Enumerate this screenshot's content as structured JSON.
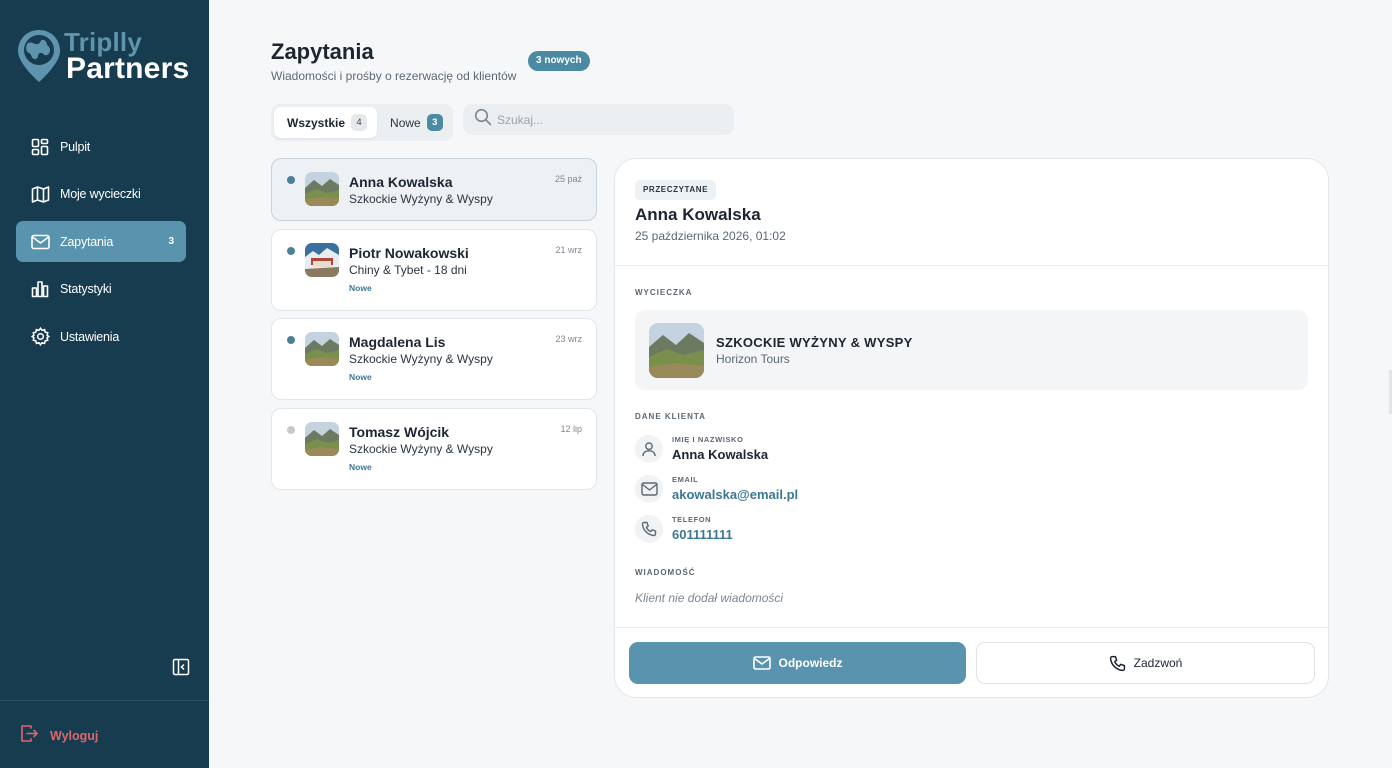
{
  "brand": {
    "name_top": "Triplly",
    "name_bottom": "Partners",
    "color_primary": "#173c4f",
    "color_accent": "#5a93ad"
  },
  "sidebar": {
    "items": [
      {
        "label": "Pulpit",
        "icon": "dashboard-icon",
        "active": false
      },
      {
        "label": "Moje wycieczki",
        "icon": "map-icon",
        "active": false
      },
      {
        "label": "Zapytania",
        "icon": "mail-icon",
        "active": true,
        "count": "3"
      },
      {
        "label": "Statystyki",
        "icon": "bar-chart-icon",
        "active": false
      },
      {
        "label": "Ustawienia",
        "icon": "gear-icon",
        "active": false
      }
    ],
    "logout_label": "Wyloguj",
    "logout_color": "#e0656b"
  },
  "header": {
    "title": "Zapytania",
    "subtitle": "Wiadomości i prośby o rezerwację od klientów",
    "new_badge": "3 nowych"
  },
  "tabs": [
    {
      "label": "Wszystkie",
      "count": "4",
      "active": true
    },
    {
      "label": "Nowe",
      "count": "3",
      "active": false
    }
  ],
  "search": {
    "placeholder": "Szukaj...",
    "value": ""
  },
  "inquiries": [
    {
      "name": "Anna Kowalska",
      "trip": "Szkockie Wyżyny & Wyspy",
      "date": "25 paź",
      "unread_dot": true,
      "new_label": "",
      "selected": true
    },
    {
      "name": "Piotr Nowakowski",
      "trip": "Chiny & Tybet - 18 dni",
      "date": "21 wrz",
      "unread_dot": true,
      "new_label": "Nowe",
      "selected": false
    },
    {
      "name": "Magdalena Lis",
      "trip": "Szkockie Wyżyny & Wyspy",
      "date": "23 wrz",
      "unread_dot": true,
      "new_label": "Nowe",
      "selected": false
    },
    {
      "name": "Tomasz Wójcik",
      "trip": "Szkockie Wyżyny & Wyspy",
      "date": "12 lip",
      "unread_dot": false,
      "new_label": "Nowe",
      "selected": false
    }
  ],
  "detail": {
    "status": "PRZECZYTANE",
    "name": "Anna Kowalska",
    "datetime": "25 października 2026, 01:02",
    "trip_section_label": "WYCIECZKA",
    "trip_title": "SZKOCKIE WYŻYNY & WYSPY",
    "trip_operator": "Horizon Tours",
    "client_section_label": "DANE KLIENTA",
    "fields": {
      "name_label": "IMIĘ I NAZWISKO",
      "name_value": "Anna Kowalska",
      "email_label": "EMAIL",
      "email_value": "akowalska@email.pl",
      "phone_label": "TELEFON",
      "phone_value": "601111111"
    },
    "message_section_label": "WIADOMOŚĆ",
    "message_text": "Klient nie dodał wiadomości",
    "reply_label": "Odpowiedz",
    "call_label": "Zadzwoń"
  }
}
